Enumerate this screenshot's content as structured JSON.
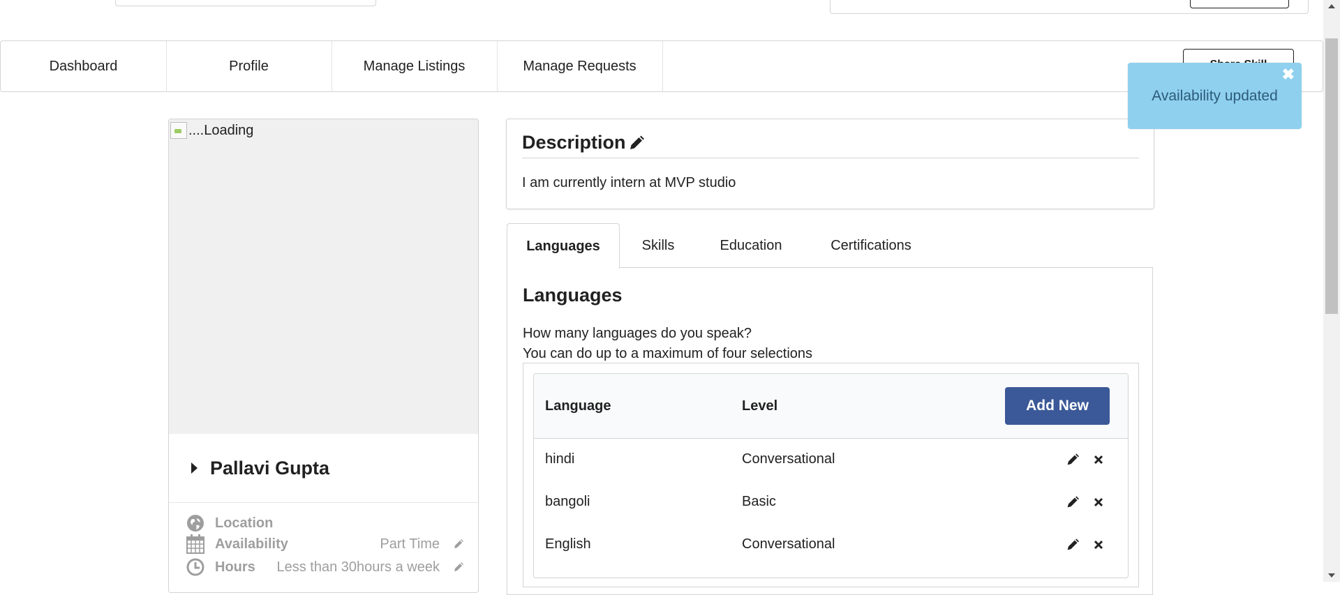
{
  "nav": {
    "items": [
      "Dashboard",
      "Profile",
      "Manage Listings",
      "Manage Requests"
    ],
    "share_button": "Share Skill"
  },
  "toast": {
    "message": "Availability updated"
  },
  "profile": {
    "image_alt": "....Loading",
    "name": "Pallavi Gupta",
    "location_label": "Location",
    "availability_label": "Availability",
    "availability_value": "Part Time",
    "hours_label": "Hours",
    "hours_value": "Less than 30hours a week"
  },
  "description": {
    "title": "Description",
    "text": "I am currently intern at MVP studio"
  },
  "tabs": [
    "Languages",
    "Skills",
    "Education",
    "Certifications"
  ],
  "languages": {
    "heading": "Languages",
    "question": "How many languages do you speak?",
    "hint": "You can do up to a maximum of four selections",
    "col_language": "Language",
    "col_level": "Level",
    "add_button": "Add New",
    "rows": [
      {
        "language": "hindi",
        "level": "Conversational"
      },
      {
        "language": "bangoli",
        "level": "Basic"
      },
      {
        "language": "English",
        "level": "Conversational"
      }
    ]
  },
  "colors": {
    "primary_button": "#3b5998",
    "toast_bg": "#8fd0ee"
  },
  "icons": [
    "pencil-icon",
    "close-icon",
    "globe-icon",
    "calendar-icon",
    "clock-icon",
    "caret-right-icon"
  ]
}
